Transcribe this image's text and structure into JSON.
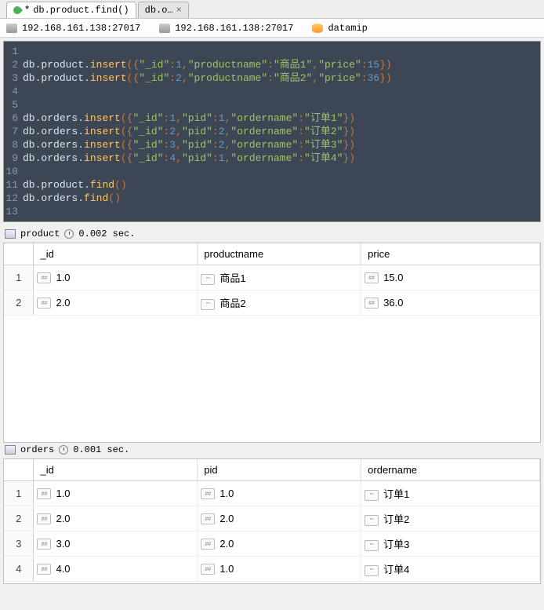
{
  "tabs": [
    {
      "title": "db.product.find()",
      "modified": true,
      "icon": "leaf"
    },
    {
      "title": "db.o…",
      "modified": false,
      "icon": "leaf"
    }
  ],
  "connection": {
    "host1": "192.168.161.138:27017",
    "host2": "192.168.161.138:27017",
    "database": "datamip"
  },
  "code_lines": [
    "",
    "db.product.insert({\"_id\":1,\"productname\":\"商品1\",\"price\":15})",
    "db.product.insert({\"_id\":2,\"productname\":\"商品2\",\"price\":36})",
    "",
    "",
    "db.orders.insert({\"_id\":1,\"pid\":1,\"ordername\":\"订单1\"})",
    "db.orders.insert({\"_id\":2,\"pid\":2,\"ordername\":\"订单2\"})",
    "db.orders.insert({\"_id\":3,\"pid\":2,\"ordername\":\"订单3\"})",
    "db.orders.insert({\"_id\":4,\"pid\":1,\"ordername\":\"订单4\"})",
    "",
    "db.product.find()",
    "db.orders.find()",
    ""
  ],
  "product_result": {
    "name": "product",
    "time": "0.002 sec.",
    "columns": [
      "_id",
      "productname",
      "price"
    ],
    "rows": [
      {
        "_id": "1.0",
        "productname": "商品1",
        "price": "15.0"
      },
      {
        "_id": "2.0",
        "productname": "商品2",
        "price": "36.0"
      }
    ]
  },
  "orders_result": {
    "name": "orders",
    "time": "0.001 sec.",
    "columns": [
      "_id",
      "pid",
      "ordername"
    ],
    "rows": [
      {
        "_id": "1.0",
        "pid": "1.0",
        "ordername": "订单1"
      },
      {
        "_id": "2.0",
        "pid": "2.0",
        "ordername": "订单2"
      },
      {
        "_id": "3.0",
        "pid": "2.0",
        "ordername": "订单3"
      },
      {
        "_id": "4.0",
        "pid": "1.0",
        "ordername": "订单4"
      }
    ]
  },
  "type_badges": {
    "num": "##",
    "str": "\"\""
  }
}
